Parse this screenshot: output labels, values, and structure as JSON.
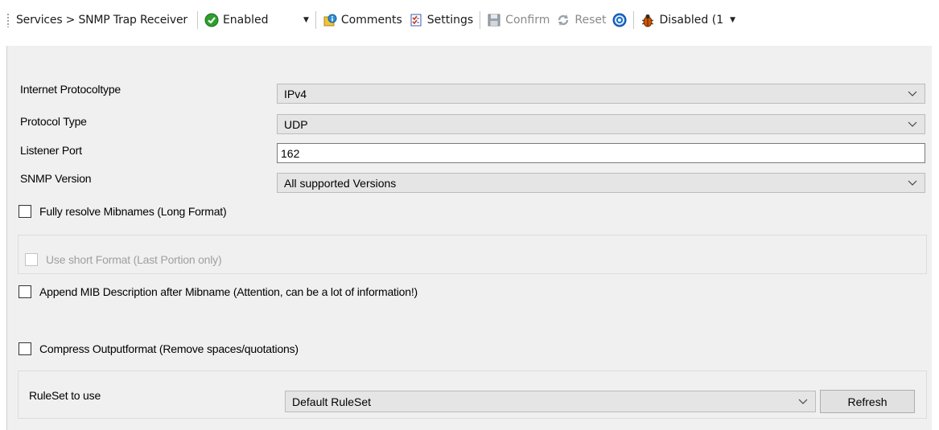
{
  "toolbar": {
    "breadcrumb": "Services > SNMP Trap Receiver",
    "status_value": "Enabled",
    "comments_label": "Comments",
    "settings_label": "Settings",
    "confirm_label": "Confirm",
    "reset_label": "Reset",
    "debug_value": "Disabled (1",
    "colors": {
      "enabled_green": "#2e9e2e",
      "help_blue": "#1f6fd1"
    }
  },
  "form": {
    "ip_protocol": {
      "label": "Internet Protocoltype",
      "value": "IPv4"
    },
    "protocol_type": {
      "label": "Protocol Type",
      "value": "UDP"
    },
    "listener_port": {
      "label": "Listener Port",
      "value": "162"
    },
    "snmp_version": {
      "label": "SNMP Version",
      "value": "All supported Versions"
    },
    "fully_resolve": {
      "label": "Fully resolve Mibnames (Long Format)",
      "checked": false
    },
    "short_format": {
      "label": "Use short Format (Last Portion only)",
      "checked": false,
      "enabled": false
    },
    "append_mib": {
      "label": "Append MIB Description after Mibname (Attention, can be a lot of information!)",
      "checked": false
    },
    "compress": {
      "label": "Compress Outputformat (Remove spaces/quotations)",
      "checked": false
    },
    "ruleset": {
      "label": "RuleSet to use",
      "value": "Default RuleSet",
      "refresh_label": "Refresh"
    }
  }
}
